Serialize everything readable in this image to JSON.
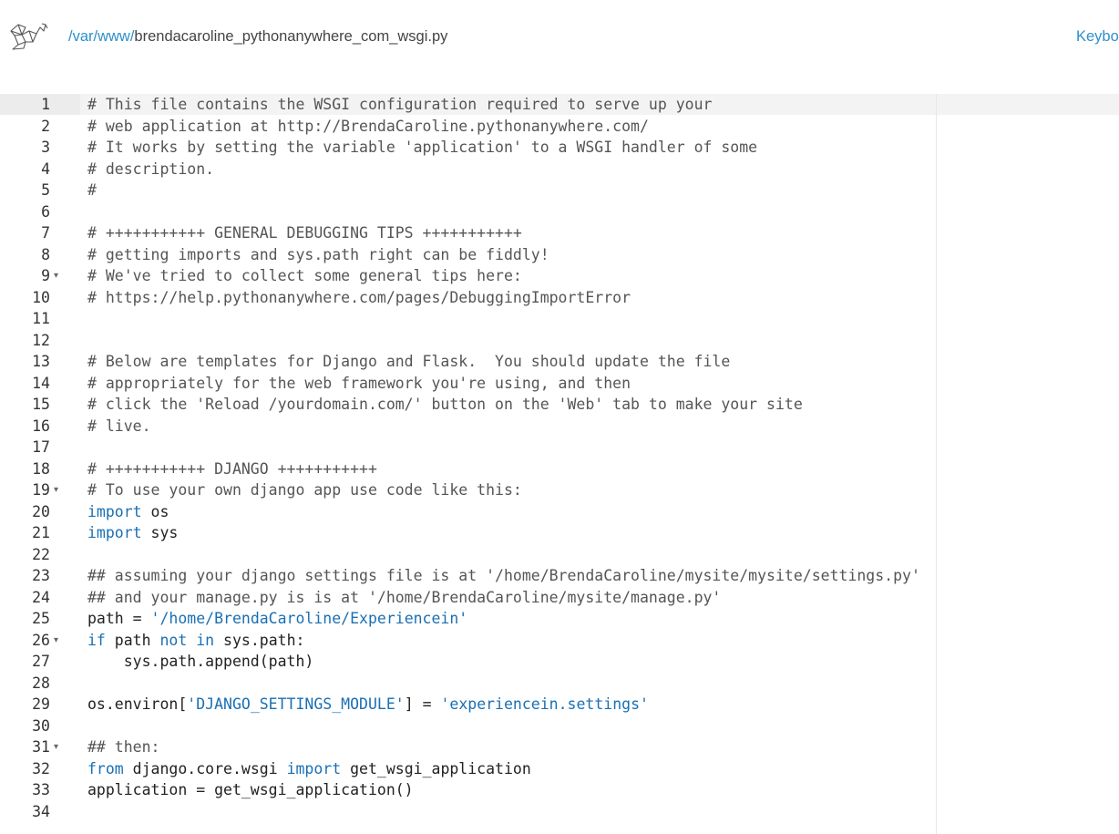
{
  "header": {
    "path_prefix": "/var/www/",
    "filename": "brendacaroline_pythonanywhere_com_wsgi.py",
    "keyboard_link": "Keybo"
  },
  "colors": {
    "link": "#2e8fc9",
    "comment": "#555555",
    "keyword": "#1a6fb3",
    "string": "#1a6fb3",
    "text": "#222222"
  },
  "icons": {
    "logo": "pythonanywhere-logo-icon",
    "fold": "fold-arrow-icon"
  },
  "editor": {
    "active_line": 1,
    "foldable_lines": [
      9,
      19,
      26,
      31
    ],
    "lines": [
      {
        "n": "1",
        "tokens": [
          {
            "t": "comment",
            "v": "# This file contains the WSGI configuration required to serve up your"
          }
        ]
      },
      {
        "n": "2",
        "tokens": [
          {
            "t": "comment",
            "v": "# web application at http://BrendaCaroline.pythonanywhere.com/"
          }
        ]
      },
      {
        "n": "3",
        "tokens": [
          {
            "t": "comment",
            "v": "# It works by setting the variable 'application' to a WSGI handler of some"
          }
        ]
      },
      {
        "n": "4",
        "tokens": [
          {
            "t": "comment",
            "v": "# description."
          }
        ]
      },
      {
        "n": "5",
        "tokens": [
          {
            "t": "comment",
            "v": "#"
          }
        ]
      },
      {
        "n": "6",
        "tokens": []
      },
      {
        "n": "7",
        "tokens": [
          {
            "t": "comment",
            "v": "# +++++++++++ GENERAL DEBUGGING TIPS +++++++++++"
          }
        ]
      },
      {
        "n": "8",
        "tokens": [
          {
            "t": "comment",
            "v": "# getting imports and sys.path right can be fiddly!"
          }
        ]
      },
      {
        "n": "9",
        "tokens": [
          {
            "t": "comment",
            "v": "# We've tried to collect some general tips here:"
          }
        ]
      },
      {
        "n": "10",
        "tokens": [
          {
            "t": "comment",
            "v": "# https://help.pythonanywhere.com/pages/DebuggingImportError"
          }
        ]
      },
      {
        "n": "11",
        "tokens": []
      },
      {
        "n": "12",
        "tokens": []
      },
      {
        "n": "13",
        "tokens": [
          {
            "t": "comment",
            "v": "# Below are templates for Django and Flask.  You should update the file"
          }
        ]
      },
      {
        "n": "14",
        "tokens": [
          {
            "t": "comment",
            "v": "# appropriately for the web framework you're using, and then"
          }
        ]
      },
      {
        "n": "15",
        "tokens": [
          {
            "t": "comment",
            "v": "# click the 'Reload /yourdomain.com/' button on the 'Web' tab to make your site"
          }
        ]
      },
      {
        "n": "16",
        "tokens": [
          {
            "t": "comment",
            "v": "# live."
          }
        ]
      },
      {
        "n": "17",
        "tokens": []
      },
      {
        "n": "18",
        "tokens": [
          {
            "t": "comment",
            "v": "# +++++++++++ DJANGO +++++++++++"
          }
        ]
      },
      {
        "n": "19",
        "tokens": [
          {
            "t": "comment",
            "v": "# To use your own django app use code like this:"
          }
        ]
      },
      {
        "n": "20",
        "tokens": [
          {
            "t": "keyword",
            "v": "import"
          },
          {
            "t": "ident",
            "v": " os"
          }
        ]
      },
      {
        "n": "21",
        "tokens": [
          {
            "t": "keyword",
            "v": "import"
          },
          {
            "t": "ident",
            "v": " sys"
          }
        ]
      },
      {
        "n": "22",
        "tokens": []
      },
      {
        "n": "23",
        "tokens": [
          {
            "t": "comment",
            "v": "## assuming your django settings file is at '/home/BrendaCaroline/mysite/mysite/settings.py'"
          }
        ]
      },
      {
        "n": "24",
        "tokens": [
          {
            "t": "comment",
            "v": "## and your manage.py is is at '/home/BrendaCaroline/mysite/manage.py'"
          }
        ]
      },
      {
        "n": "25",
        "tokens": [
          {
            "t": "ident",
            "v": "path = "
          },
          {
            "t": "string",
            "v": "'/home/BrendaCaroline/Experiencein'"
          }
        ]
      },
      {
        "n": "26",
        "tokens": [
          {
            "t": "keyword",
            "v": "if"
          },
          {
            "t": "ident",
            "v": " path "
          },
          {
            "t": "keyword",
            "v": "not"
          },
          {
            "t": "ident",
            "v": " "
          },
          {
            "t": "keyword",
            "v": "in"
          },
          {
            "t": "ident",
            "v": " sys.path:"
          }
        ]
      },
      {
        "n": "27",
        "tokens": [
          {
            "t": "ident",
            "v": "    sys.path.append(path)"
          }
        ]
      },
      {
        "n": "28",
        "tokens": []
      },
      {
        "n": "29",
        "tokens": [
          {
            "t": "ident",
            "v": "os.environ["
          },
          {
            "t": "string",
            "v": "'DJANGO_SETTINGS_MODULE'"
          },
          {
            "t": "ident",
            "v": "] = "
          },
          {
            "t": "string",
            "v": "'experiencein.settings'"
          }
        ]
      },
      {
        "n": "30",
        "tokens": []
      },
      {
        "n": "31",
        "tokens": [
          {
            "t": "comment",
            "v": "## then:"
          }
        ]
      },
      {
        "n": "32",
        "tokens": [
          {
            "t": "keyword",
            "v": "from"
          },
          {
            "t": "ident",
            "v": " django.core.wsgi "
          },
          {
            "t": "keyword",
            "v": "import"
          },
          {
            "t": "ident",
            "v": " get_wsgi_application"
          }
        ]
      },
      {
        "n": "33",
        "tokens": [
          {
            "t": "ident",
            "v": "application = get_wsgi_application()"
          }
        ]
      },
      {
        "n": "34",
        "tokens": []
      }
    ]
  }
}
